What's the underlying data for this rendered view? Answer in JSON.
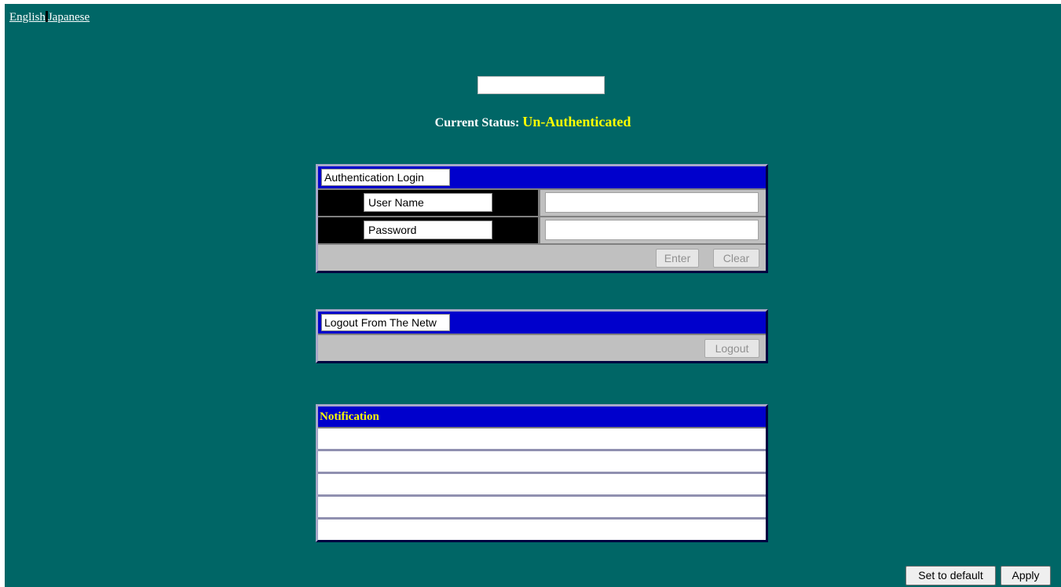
{
  "languages": {
    "english": "English",
    "japanese": "Japanese"
  },
  "status": {
    "label": "Current Status:",
    "value": "Un-Authenticated"
  },
  "login_panel": {
    "title": "Authentication Login",
    "username_label": "User Name",
    "password_label": "Password",
    "username_value": "",
    "password_value": "",
    "enter_label": "Enter",
    "clear_label": "Clear"
  },
  "logout_panel": {
    "title": "Logout From The Netw",
    "logout_label": "Logout"
  },
  "notification": {
    "title": "Notification",
    "rows": [
      "",
      "",
      "",
      "",
      ""
    ]
  },
  "footer": {
    "set_default_label": "Set to default",
    "apply_label": "Apply"
  },
  "colors": {
    "background": "#006666",
    "panel_header": "#0000cc",
    "status_value": "#ffff00"
  }
}
